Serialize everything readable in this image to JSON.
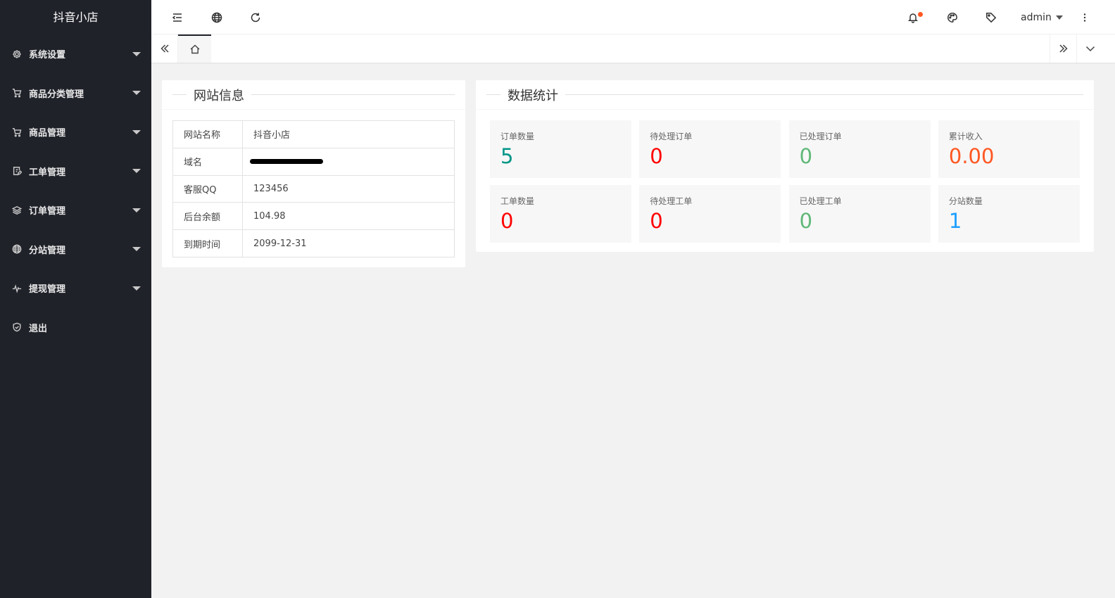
{
  "app": {
    "title": "抖音小店"
  },
  "sidebar": {
    "items": [
      {
        "label": "系统设置",
        "icon": "gear-icon",
        "has_submenu": true
      },
      {
        "label": "商品分类管理",
        "icon": "cart-icon",
        "has_submenu": true
      },
      {
        "label": "商品管理",
        "icon": "cart-icon",
        "has_submenu": true
      },
      {
        "label": "工单管理",
        "icon": "edit-doc-icon",
        "has_submenu": true
      },
      {
        "label": "订单管理",
        "icon": "layers-icon",
        "has_submenu": true
      },
      {
        "label": "分站管理",
        "icon": "globe-icon",
        "has_submenu": true
      },
      {
        "label": "提现管理",
        "icon": "pulse-icon",
        "has_submenu": true
      },
      {
        "label": "退出",
        "icon": "shield-icon",
        "has_submenu": false
      }
    ]
  },
  "header": {
    "icons": [
      "menu-toggle-icon",
      "globe-icon",
      "refresh-icon",
      "bell-icon",
      "palette-icon",
      "tag-icon",
      "more-vertical-icon"
    ],
    "user": "admin"
  },
  "tabs": {
    "home_icon": "home-icon"
  },
  "site_info": {
    "title": "网站信息",
    "rows": [
      {
        "key": "网站名称",
        "value": "抖音小店"
      },
      {
        "key": "域名",
        "value": ""
      },
      {
        "key": "客服QQ",
        "value": "123456"
      },
      {
        "key": "后台余额",
        "value": "104.98"
      },
      {
        "key": "到期时间",
        "value": "2099-12-31"
      }
    ]
  },
  "stats": {
    "title": "数据统计",
    "items": [
      {
        "label": "订单数量",
        "value": "5",
        "color": "#009688"
      },
      {
        "label": "待处理订单",
        "value": "0",
        "color": "#ff0000"
      },
      {
        "label": "已处理订单",
        "value": "0",
        "color": "#5fb878"
      },
      {
        "label": "累计收入",
        "value": "0.00",
        "color": "#ff5722"
      },
      {
        "label": "工单数量",
        "value": "0",
        "color": "#ff0000"
      },
      {
        "label": "待处理工单",
        "value": "0",
        "color": "#ff0000"
      },
      {
        "label": "已处理工单",
        "value": "0",
        "color": "#5fb878"
      },
      {
        "label": "分站数量",
        "value": "1",
        "color": "#1e9fff"
      }
    ]
  },
  "colors": {
    "sidebar_bg": "#20222a",
    "page_bg": "#f2f2f2",
    "notification_dot": "#ff5722"
  }
}
